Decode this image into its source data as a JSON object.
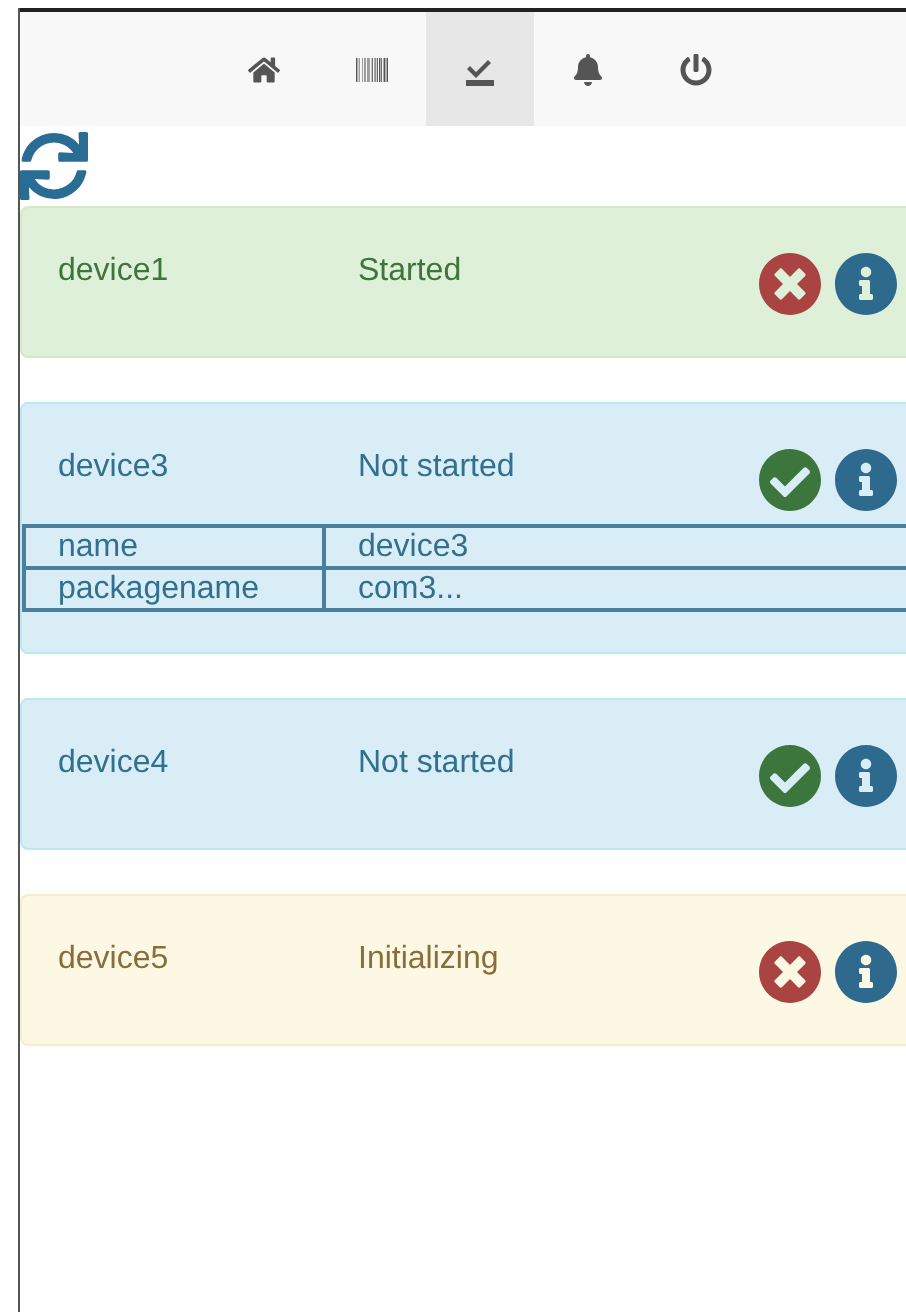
{
  "nav": [
    {
      "kind": "home",
      "selected": false
    },
    {
      "kind": "barcode",
      "selected": false
    },
    {
      "kind": "tasks",
      "selected": true
    },
    {
      "kind": "bell",
      "selected": false
    },
    {
      "kind": "power",
      "selected": false
    }
  ],
  "devices": [
    {
      "name": "device1",
      "status": "Started",
      "kind": "success",
      "action": {
        "kind": "stop"
      }
    },
    {
      "name": "device3",
      "status": "Not started",
      "kind": "info",
      "action": {
        "kind": "start"
      },
      "details": [
        {
          "key": "name",
          "value": "device3"
        },
        {
          "key": "packagename",
          "value": "com3..."
        }
      ]
    },
    {
      "name": "device4",
      "status": "Not started",
      "kind": "info",
      "action": {
        "kind": "start"
      }
    },
    {
      "name": "device5",
      "status": "Initializing",
      "kind": "warning",
      "action": {
        "kind": "stop"
      }
    }
  ]
}
